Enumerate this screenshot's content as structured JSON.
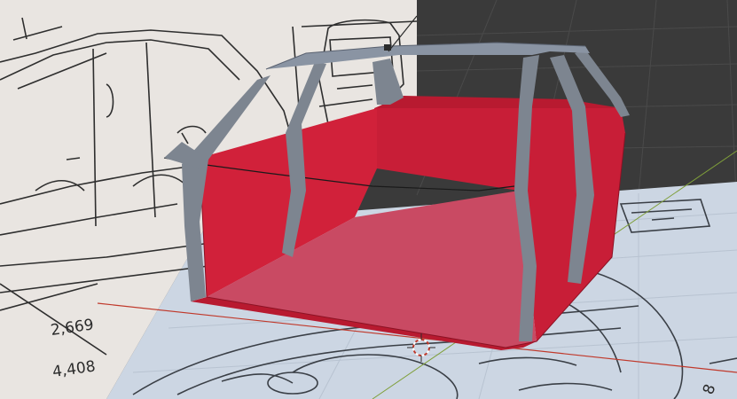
{
  "viewport": {
    "background_color": "#3a3a3a",
    "grid_color": "#4a4a4a",
    "x_axis_color": "#c0392b",
    "y_axis_color": "#7f9f3a"
  },
  "reference_side": {
    "paper_color": "#e9e5e1",
    "line_color": "#2e2e2e",
    "dimensions": [
      "2,669",
      "4,408"
    ]
  },
  "reference_top": {
    "paper_color": "#ccd6e3",
    "line_color": "#3a3f46",
    "edge_digit": "8"
  },
  "model": {
    "body_color": "#d1213a",
    "body_dark_color": "#b81a30",
    "floor_color": "#c94a63",
    "pillar_color": "#7d8590",
    "roof_color": "#8a94a3"
  },
  "cursor_icon": "3d-cursor-icon"
}
